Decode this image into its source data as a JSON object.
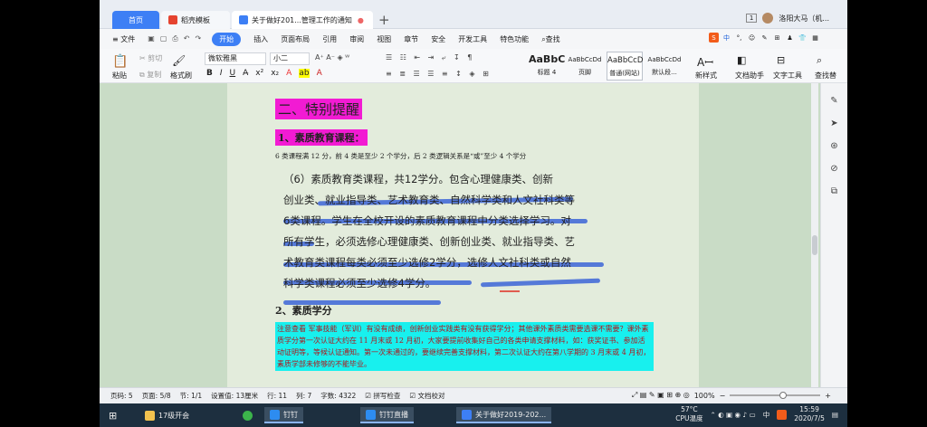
{
  "tabs": {
    "home": "首页",
    "templates": "稻壳模板",
    "document": "关于做好201...管理工作的通知"
  },
  "titlebar": {
    "badge": "1",
    "user": "洛阳大马（机..."
  },
  "menu": {
    "file": "文件",
    "items": [
      "开始",
      "插入",
      "页面布局",
      "引用",
      "审阅",
      "视图",
      "章节",
      "安全",
      "开发工具",
      "特色功能"
    ],
    "search": "查找",
    "sogou": [
      "中",
      "°,",
      "☺",
      "✎",
      "⊞",
      "♟",
      "👕",
      "▦"
    ]
  },
  "ribbon": {
    "paste": "粘贴",
    "cut": "剪切",
    "copy": "复制",
    "format_painter": "格式刷",
    "font": "微软雅黑",
    "size": "小二",
    "bold": "B",
    "italic": "I",
    "underline": "U",
    "styles": [
      {
        "preview": "AaBbC",
        "label": "标题 4"
      },
      {
        "preview": "AaBbCcDd",
        "label": "页脚"
      },
      {
        "preview": "AaBbCcD",
        "label": "普通(网站)"
      },
      {
        "preview": "AaBbCcDd",
        "label": "默认段..."
      }
    ],
    "new_style": "新样式",
    "doc_helper": "文档助手",
    "text_tools": "文字工具",
    "find_replace": "查找替"
  },
  "document": {
    "heading": "二、特别提醒",
    "subheading": "1、素质教育课程：",
    "note": "6 类课程满 12 分，前 4 类是至少 2 个学分，后 2 类逻辑关系是“或”至少 4 个学分",
    "para_lines": [
      "（6）素质教育类课程，共12学分。包含心理健康类、创新",
      "创业类、就业指导类、艺术教育类、自然科学类和人文社科类等",
      "6类课程。学生在全校开设的素质教育课程中分类选择学习。对",
      "所有学生，必须选修心理健康类、创新创业类、就业指导类、艺",
      "术教育类课程每类必须至少选修2学分，选修人文社科类或自然",
      "科学类课程必须至少选修4学分。"
    ],
    "section2": "2、素质学分",
    "cyan_text": "注意查看   军事技能（军训）有没有成绩，创新创业实践类有没有获得学分；其他课外素质类需要选课不需要？课外素质学分第一次认证大约在 11 月末或 12 月初，大家要提前收集好自己的各类申请支撑材料，如：获奖证书、参加活动证明等，等候认证通知。第一次未通过的，要继续完善支撑材料，第二次认证大约在第八学期的 3 月末或 4 月初，素质学部未修够的不能毕业。"
  },
  "status": {
    "page_num": "页码: 5",
    "page": "页面: 5/8",
    "section": "节: 1/1",
    "setting": "设置值: 13厘米",
    "row": "行: 11",
    "col": "列: 7",
    "words": "字数: 4322",
    "spell": "拼写检查",
    "proof": "文档校对",
    "zoom": "100%"
  },
  "zoom_level": 0.6,
  "taskbar": {
    "items": [
      "17级开会",
      "钉钉",
      "钉钉直播",
      "关于做好2019-202..."
    ],
    "temp": "57°C",
    "cpu": "CPU温度",
    "ime": "中",
    "time": "15:59",
    "date": "2020/7/5"
  }
}
